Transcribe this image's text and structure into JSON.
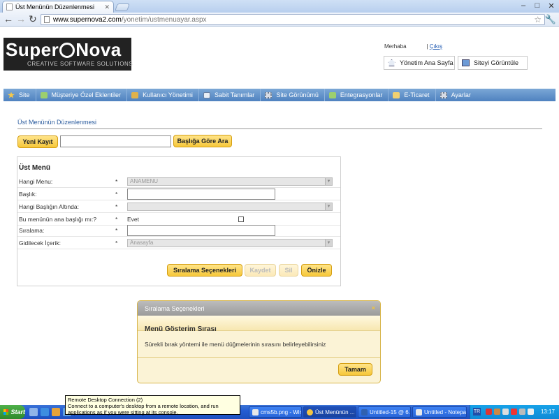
{
  "browser": {
    "tab_title": "Üst Menünün Düzenlenmesi",
    "url_host": "www.supernova2.com",
    "url_path": "/yonetim/ustmenuayar.aspx"
  },
  "header": {
    "logo_left": "Super",
    "logo_right": "Nova",
    "logo_tagline": "CREATIVE SOFTWARE SOLUTIONS",
    "greeting": "Merhaba",
    "logout_label": "Çıkış",
    "home_button": "Yönetim Ana Sayfa",
    "view_site_button": "Siteyi Görüntüle"
  },
  "nav": {
    "items": [
      {
        "label": "Site",
        "icon": "star-icon"
      },
      {
        "label": "Müşteriye Özel Eklentiler",
        "icon": "plugin-icon"
      },
      {
        "label": "Kullanıcı Yönetimi",
        "icon": "user-icon"
      },
      {
        "label": "Sabit Tanımlar",
        "icon": "document-icon"
      },
      {
        "label": "Site Görünümü",
        "icon": "gear-icon"
      },
      {
        "label": "Entegrasyonlar",
        "icon": "plugin-icon"
      },
      {
        "label": "E-Ticaret",
        "icon": "cart-icon"
      },
      {
        "label": "Ayarlar",
        "icon": "gear-icon"
      }
    ]
  },
  "main": {
    "title": "Üst Menünün Düzenlenmesi",
    "new_record_button": "Yeni Kayıt",
    "search_value": "",
    "search_button": "Başlığa Göre Ara"
  },
  "form": {
    "heading": "Üst Menü",
    "required_mark": "*",
    "fields": {
      "menu": {
        "label": "Hangi Menu:",
        "value": "ANAMENU"
      },
      "title": {
        "label": "Başlık:",
        "value": ""
      },
      "parent": {
        "label": "Hangi Başlığın Altında:",
        "value": ""
      },
      "is_main": {
        "label": "Bu menünün ana başlığı mı:?",
        "option": "Evet",
        "checked": false
      },
      "order": {
        "label": "Sıralama:",
        "value": ""
      },
      "content": {
        "label": "Gidilecek İçerik:",
        "value": "Anasayfa"
      }
    },
    "buttons": {
      "order_options": "Sıralama Seçenekleri",
      "save": "Kaydet",
      "delete": "Sil",
      "preview": "Önizle"
    }
  },
  "modal": {
    "title": "Sıralama Seçenekleri",
    "close": "×",
    "heading": "Menü Gösterim Sırası",
    "text": "Sürekli bırak yöntemi ile menü düğmelerinin sırasını belirleyebilirsiniz",
    "ok_button": "Tamam"
  },
  "taskbar": {
    "start": "Start",
    "tasks": [
      {
        "label": "cms5b.png - Win..."
      },
      {
        "label": "Üst Menünün ..."
      },
      {
        "label": "Untitled-15 @ 6..."
      },
      {
        "label": "Untitled - Notepad"
      }
    ],
    "language": "TR",
    "clock": "13:17"
  },
  "tooltip": {
    "title": "Remote Desktop Connection (2)",
    "text": "Connect to a computer's desktop from a remote location, and run applications as if you were sitting at its console."
  },
  "colors": {
    "nav_bar": "#4f82c0",
    "button_yellow": "#f6c73a",
    "title_blue": "#2b5c9e",
    "modal_bg": "#fbf3d6"
  }
}
